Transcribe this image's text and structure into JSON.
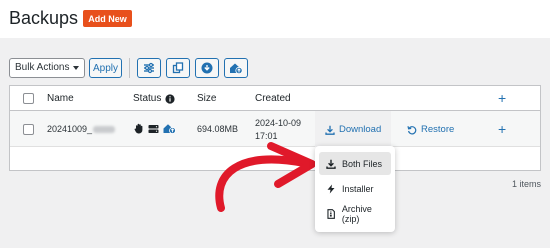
{
  "page": {
    "title": "Backups",
    "add_new_label": "Add New"
  },
  "toolbar": {
    "bulk_actions_label": "Bulk Actions",
    "apply_label": "Apply",
    "icon_buttons": [
      "filter-settings-icon",
      "copy-icon",
      "download-circle-icon",
      "house-upload-icon"
    ]
  },
  "table": {
    "columns": [
      "Name",
      "Status",
      "Size",
      "Created"
    ],
    "status_info_icon": "info-icon",
    "add_column_icon": "plus-icon",
    "rows": [
      {
        "name": "20241009_",
        "status_icons": [
          "hand-stop-icon",
          "server-icon",
          "house-cloud-icon"
        ],
        "size": "694.08MB",
        "created_date": "2024-10-09",
        "created_time": "17:01",
        "download_label": "Download",
        "restore_label": "Restore"
      }
    ]
  },
  "pagination": {
    "items_count": "1 items"
  },
  "download_menu": {
    "items": [
      {
        "label": "Both Files",
        "icon": "download-icon",
        "active": true
      },
      {
        "label": "Installer",
        "icon": "bolt-icon",
        "active": false
      },
      {
        "label": "Archive (zip)",
        "icon": "file-zip-icon",
        "active": false
      }
    ]
  },
  "colors": {
    "accent": "#2271b1",
    "add_new": "#e8501c",
    "annotation_arrow": "#e0192a"
  }
}
